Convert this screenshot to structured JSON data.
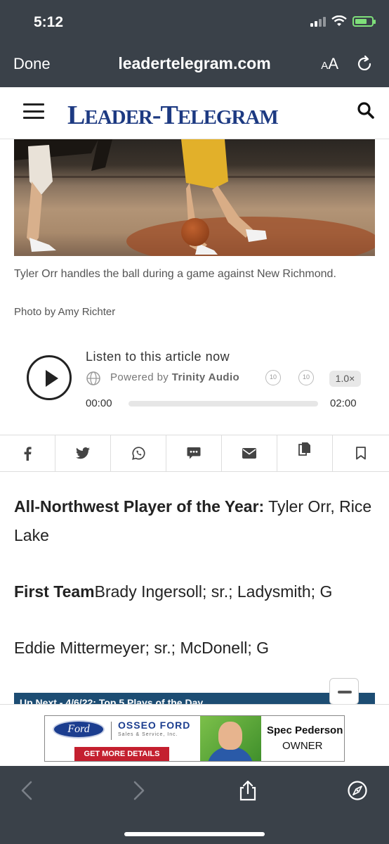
{
  "status_bar": {
    "time": "5:12"
  },
  "browser": {
    "done_label": "Done",
    "url": "leadertelegram.com",
    "text_size_label_small": "A",
    "text_size_label_large": "A"
  },
  "site": {
    "logo_first": "L",
    "logo_first_rest": "EADER",
    "logo_dash": "-",
    "logo_second": "T",
    "logo_second_rest": "ELEGRAM"
  },
  "photo": {
    "caption": "Tyler Orr handles the ball during a game against New Richmond.",
    "credit": "Photo by Amy Richter"
  },
  "audio": {
    "title": "Listen to this article now",
    "powered_prefix": "Powered by",
    "powered_brand": "Trinity Audio",
    "skip_back_label": "10",
    "skip_forward_label": "10",
    "speed": "1.0×",
    "time_start": "00:00",
    "time_end": "02:00",
    "progress": 0
  },
  "share": [
    "facebook-icon",
    "twitter-icon",
    "whatsapp-icon",
    "sms-icon",
    "email-icon",
    "copy-icon",
    "bookmark-icon"
  ],
  "article": {
    "p1_bold": "All-Northwest Player of the Year:",
    "p1_text": " Tyler Orr, Rice Lake",
    "p2_bold": "First Team",
    "p2_text": "Brady Ingersoll; sr.; Ladysmith; G",
    "p3_text": "Eddie Mittermeyer; sr.; McDonell; G"
  },
  "up_next": {
    "label": "Up Next - 4/6/22: Top 5 Plays of the Day"
  },
  "ad": {
    "ford_logo": "Ford",
    "brand": "OSSEO FORD",
    "tagline": "Sales & Service, Inc.",
    "cta": "GET MORE DETAILS",
    "name": "Spec Pederson",
    "role": "OWNER"
  },
  "colors": {
    "chrome": "#3a4149",
    "logo_blue": "#1d3a82",
    "battery_green": "#7fe07a",
    "ad_red": "#c4202f"
  }
}
